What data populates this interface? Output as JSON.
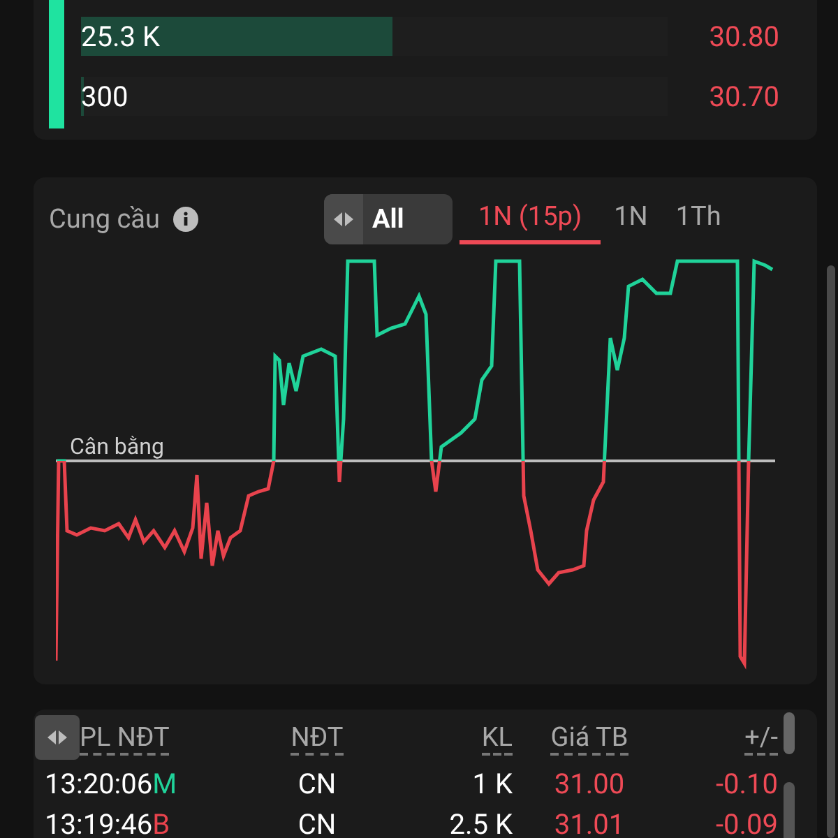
{
  "order_rows": [
    {
      "volume": "25.3 K",
      "level": 0.53,
      "price": "30.80"
    },
    {
      "volume": "300",
      "level": 0.005,
      "price": "30.70"
    }
  ],
  "supply_demand": {
    "title": "Cung cầu",
    "filter": "All",
    "tabs": [
      {
        "label": "1N (15p)",
        "selected": true
      },
      {
        "label": "1N",
        "selected": false
      },
      {
        "label": "1Th",
        "selected": false
      }
    ],
    "balance_label": "Cân bằng"
  },
  "trades": {
    "columns": [
      "PL NĐT",
      "NĐT",
      "KL",
      "Giá TB",
      "+/-"
    ],
    "rows": [
      {
        "time": "13:20:06",
        "side": "M",
        "color": "#20d39a",
        "investor": "CN",
        "volume": "1 K",
        "avg_price": "31.00",
        "change": "-0.10"
      },
      {
        "time": "13:19:46",
        "side": "B",
        "color": "#e8434d",
        "investor": "CN",
        "volume": "2.5 K",
        "avg_price": "31.01",
        "change": "-0.09"
      }
    ]
  }
}
